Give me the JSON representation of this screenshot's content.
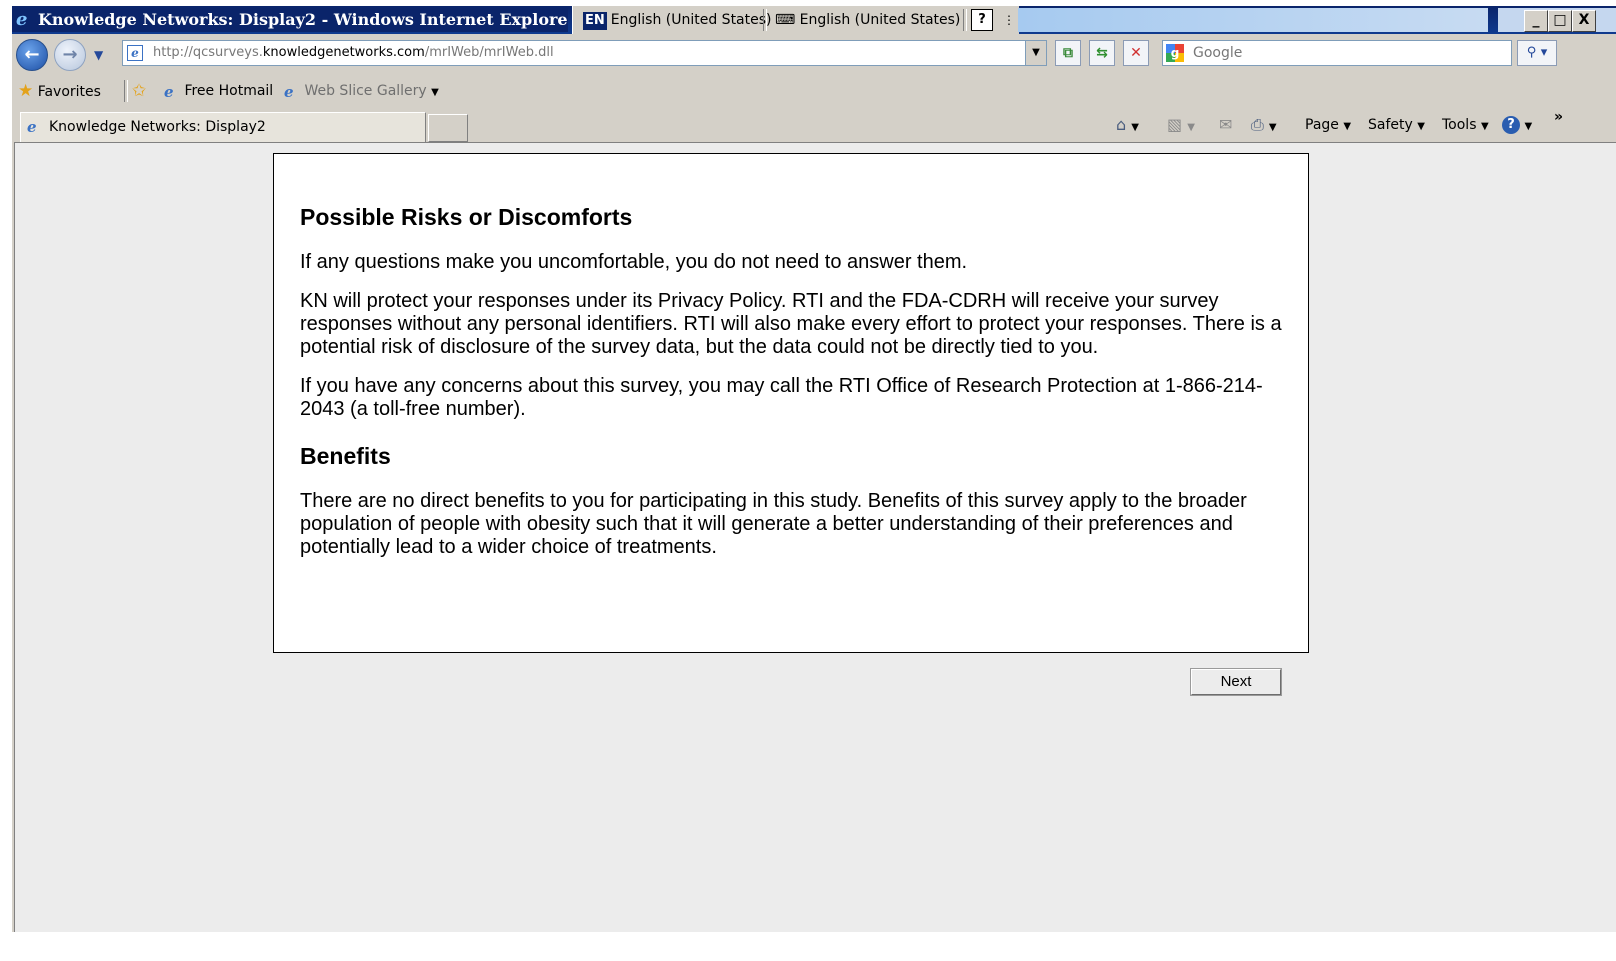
{
  "window": {
    "title": "Knowledge Networks: Display2 - Windows Internet Explorer",
    "language_indicator": "EN",
    "input_language": "English (United States)",
    "keyboard_layout": "English (United States)",
    "help_glyph": "?",
    "minimize": "_",
    "maximize": "□",
    "close": "X"
  },
  "address_bar": {
    "url_prefix": "http://qcsurveys.",
    "url_domain": "knowledgenetworks.com",
    "url_path": "/mrIWeb/mrIWeb.dll",
    "search_placeholder": "Google"
  },
  "favorites_bar": {
    "favorites_label": "Favorites",
    "items": [
      {
        "label": "Free Hotmail"
      },
      {
        "label": "Web Slice Gallery"
      }
    ]
  },
  "tabs": [
    {
      "label": "Knowledge Networks: Display2",
      "active": true
    }
  ],
  "command_bar": {
    "page": "Page",
    "safety": "Safety",
    "tools": "Tools",
    "overflow": "»"
  },
  "content": {
    "sections": [
      {
        "heading": "Possible Risks or Discomforts",
        "paragraphs": [
          "If any questions make you uncomfortable, you do not need to answer them.",
          "KN will protect your responses under its Privacy Policy. RTI and the FDA-CDRH will receive your survey responses without any personal identifiers. RTI will also make every effort to protect your responses. There is a potential risk of disclosure of the survey data, but the data could not be directly tied to you.",
          "If you have any concerns about this survey, you may call the RTI Office of Research Protection at 1-866-214-2043 (a toll-free number)."
        ]
      },
      {
        "heading": "Benefits",
        "paragraphs": [
          "There are no direct benefits to you for participating in this study. Benefits of this survey apply to the broader population of people with obesity such that it will generate a better understanding of their preferences and potentially lead to a wider choice of treatments."
        ]
      }
    ],
    "next_button": "Next"
  },
  "icons": {
    "back": "arrow-left-icon",
    "forward": "arrow-right-icon",
    "home": "home-icon",
    "feeds": "rss-icon",
    "mail": "mail-icon",
    "print": "printer-icon",
    "help": "help-icon"
  },
  "colors": {
    "title_bar": "#0a246a",
    "chrome": "#d4d0c8",
    "content_bg": "#ececec"
  }
}
